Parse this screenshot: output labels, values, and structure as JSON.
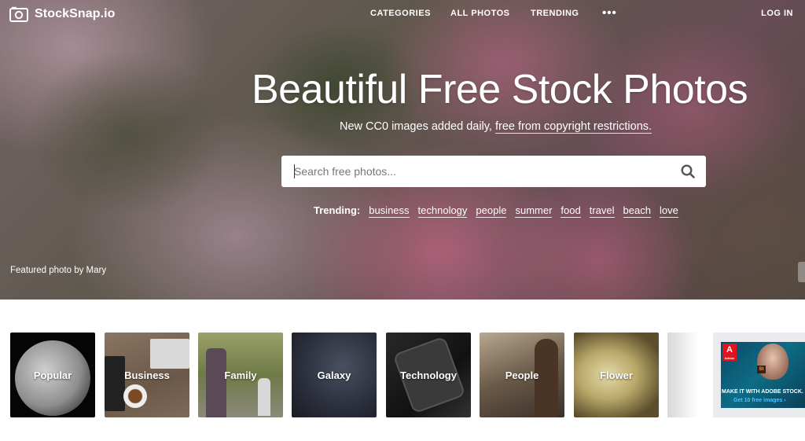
{
  "header": {
    "logo_text": "StockSnap.io",
    "nav": [
      "CATEGORIES",
      "ALL PHOTOS",
      "TRENDING"
    ],
    "more_label": "•••",
    "login_label": "LOG IN"
  },
  "hero": {
    "headline": "Beautiful Free Stock Photos",
    "subline_prefix": "New CC0 images added daily, ",
    "subline_link": "free from copyright restrictions.",
    "search_placeholder": "Search free photos...",
    "trending_label": "Trending:",
    "trending_tags": [
      "business",
      "technology",
      "people",
      "summer",
      "food",
      "travel",
      "beach",
      "love"
    ],
    "featured_prefix": "Featured photo by",
    "featured_author": "Mary"
  },
  "categories": [
    "Popular",
    "Business",
    "Family",
    "Galaxy",
    "Technology",
    "People",
    "Flower"
  ],
  "ad": {
    "logo_text": "A",
    "logo_sub": "Adobe",
    "stock_badge": "St",
    "line1": "MAKE IT WITH ADOBE STOCK.",
    "line2": "Get 10 free images ›"
  },
  "colors": {
    "nav_text": "#ffffff",
    "ad_accent": "#4fc3ff",
    "adobe_red": "#e0131f"
  },
  "icons": [
    "camera-logo-icon",
    "search-icon",
    "more-dots-icon"
  ]
}
